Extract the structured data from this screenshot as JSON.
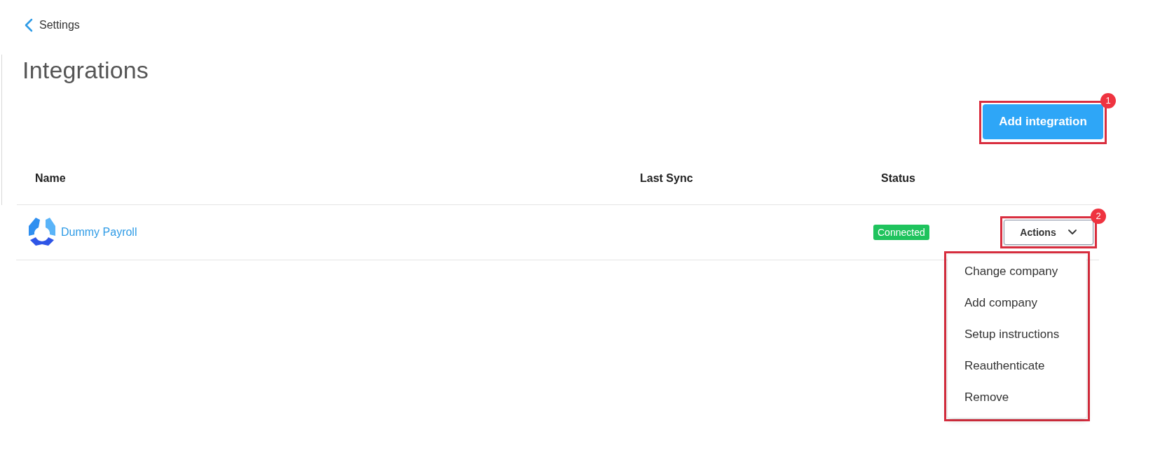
{
  "back_link": {
    "label": "Settings"
  },
  "page_title": "Integrations",
  "add_button": {
    "label": "Add integration",
    "highlighted": true,
    "badge": "1"
  },
  "table": {
    "columns": [
      "Name",
      "Last Sync",
      "Status"
    ],
    "rows": [
      {
        "name": "Dummy Payroll",
        "status": "Connected",
        "actions": {
          "label": "Actions",
          "expanded": true,
          "highlighted": true,
          "badge": "2",
          "menu": {
            "highlighted": true,
            "items": [
              "Change company",
              "Add company",
              "Setup instructions",
              "Reauthenticate",
              "Remove"
            ]
          }
        }
      }
    ]
  }
}
